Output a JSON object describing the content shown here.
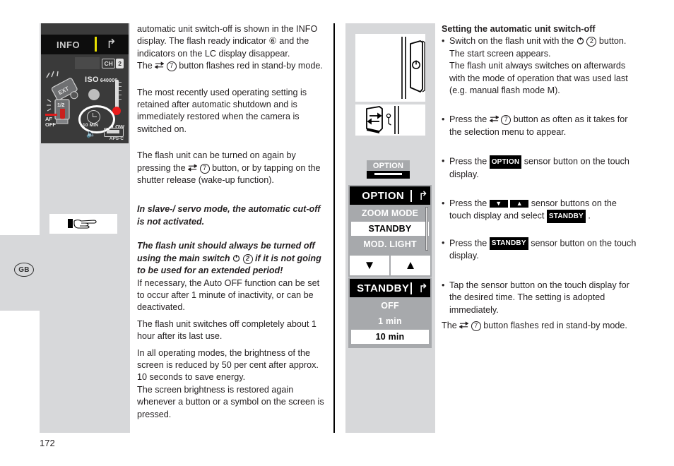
{
  "page": {
    "number": "172",
    "language_badge": "GB"
  },
  "info_display": {
    "title": "INFO",
    "back_icon": "back-arrow-icon",
    "channel_label": "CH",
    "channel_value": "2",
    "iso_label": "ISO",
    "iso_value": "640000",
    "flash_head_label": "EXT",
    "power_ratio": "1/2",
    "af_off": "AF\nOFF",
    "af_line1": "AF",
    "af_line2": "OFF",
    "standby_time": "10 MIN",
    "battery_label": "LOW",
    "sensor_format": "APS-C"
  },
  "left_column": {
    "para1": "automatic unit switch-off is shown in the INFO display. The flash ready indicator ⑥ and the indicators on the LC display disappear.",
    "para2_pre": "The ",
    "para2_post": " button flashes red in stand-by mode.",
    "para2_num": "7",
    "para3": "The most recently used operating setting is retained after automatic shutdown and is immediately restored when the camera is switched on.",
    "para4_pre": "The flash unit can be turned on again by pressing the ",
    "para4_post": " button, or by tapping on the shutter release (wake-up function).",
    "para4_num": "7",
    "note1": "In slave-/ servo mode, the automatic cut-off is not activated.",
    "note2_pre": "The flash unit should always be turned off using the main switch ",
    "note2_post": " if it is not going to be used for an extended period!",
    "note2_num": "2",
    "para5": "If necessary, the Auto OFF function can be set to occur after 1 minute of inactivity, or can be deactivated.",
    "para6": "The flash unit switches off completely about 1 hour after its last use.",
    "para7": "In all operating modes, the brightness of the screen is reduced by 50 per cent after approx. 10 seconds to save energy.",
    "para8": "The screen brightness is restored again whenever a button or a symbol on the screen is pressed.",
    "hand_icon": "pointing-hand-icon"
  },
  "middle_column": {
    "illustration_1": "flash-side-view-power-button",
    "illustration_2": "flash-side-view-mode-button",
    "option_sensor_label": "OPTION",
    "menu_option": {
      "title": "OPTION",
      "back_icon": "back-arrow-icon",
      "rows": [
        {
          "label": "ZOOM MODE",
          "state": "normal"
        },
        {
          "label": "STANDBY",
          "state": "selected"
        },
        {
          "label": "MOD. LIGHT",
          "state": "normal"
        }
      ],
      "arrow_down": "▼",
      "arrow_up": "▲"
    },
    "menu_standby": {
      "title": "STANDBY",
      "back_icon": "back-arrow-icon",
      "rows": [
        {
          "label": "OFF",
          "state": "normal"
        },
        {
          "label": "1 min",
          "state": "normal"
        },
        {
          "label": "10 min",
          "state": "selected"
        }
      ]
    }
  },
  "right_column": {
    "heading": "Setting the automatic unit switch-off",
    "bullet1_pre": "Switch on the flash unit with the ",
    "bullet1_num": "2",
    "bullet1_post": " button. The start screen appears.",
    "bullet1_extra": "The flash unit always switches on afterwards with the mode of operation that was used last (e.g. manual flash mode M).",
    "bullet2_pre": "Press the ",
    "bullet2_num": "7",
    "bullet2_post": " button as often as it takes for the selection menu to appear.",
    "bullet3_pre": "Press the ",
    "bullet3_tag": "OPTION",
    "bullet3_post": " sensor button on the touch display.",
    "bullet4_pre": "Press the ",
    "bullet4_mid": " sensor buttons on the touch display and select ",
    "bullet4_tag": "STANDBY",
    "bullet4_post": " .",
    "bullet5_pre": "Press the ",
    "bullet5_tag": "STANDBY",
    "bullet5_post": " sensor button on the touch display.",
    "bullet6": "Tap the sensor button on the touch display for the desired time. The setting is adopted immediately.",
    "closing_pre": "The ",
    "closing_num": "7",
    "closing_post": " button flashes red in stand-by mode."
  }
}
